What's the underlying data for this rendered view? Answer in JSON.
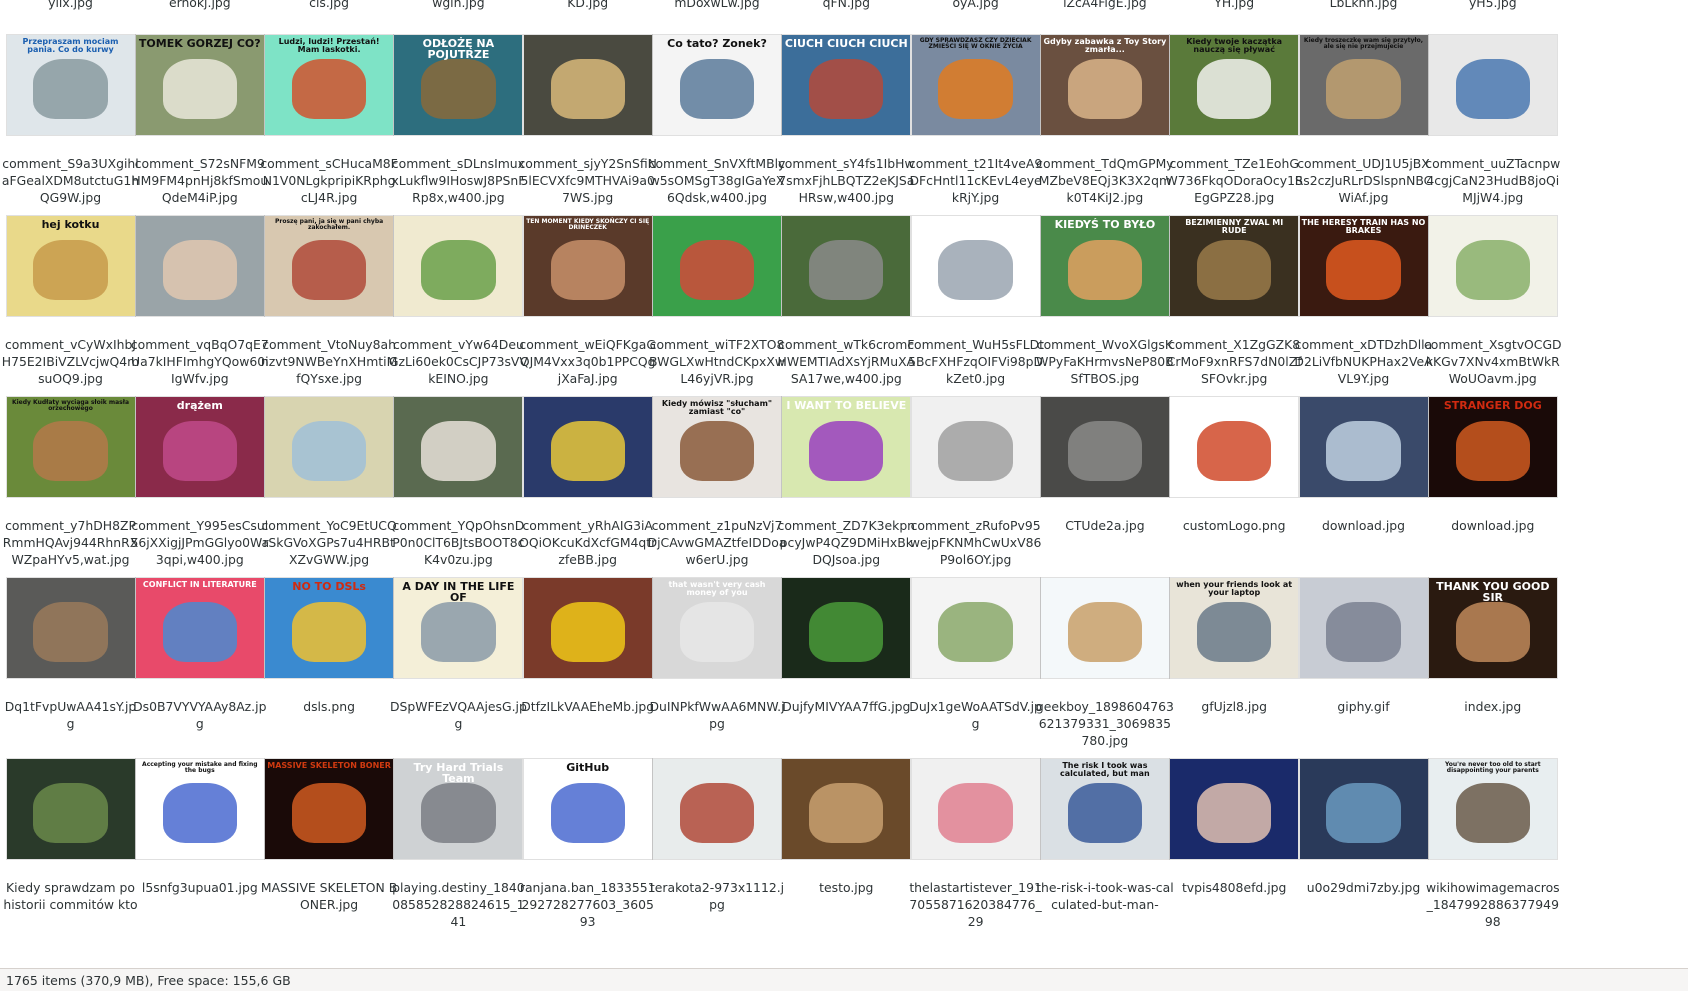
{
  "top_row": {
    "names": [
      "yiix.jpg",
      "ernokj.jpg",
      "cis.jpg",
      "wgin.jpg",
      "KD.jpg",
      "mDoxwLw.jpg",
      "qFN.jpg",
      "oyA.jpg",
      "iZcA4FigE.jpg",
      "YH.jpg",
      "LbLkhh.jpg",
      "yH5.jpg"
    ]
  },
  "rows": [
    {
      "items": [
        {
          "name": "comment_S9a3UXgihlaFGealXDM8utctuG1hQG9W.jpg",
          "thumb": {
            "bg": "#dfe6ea",
            "fg": "#8a9aa0",
            "caption": "Przepraszam mociam pania. Co do kurwy",
            "cap_color": "#1b5fb0"
          }
        },
        {
          "name": "comment_S72sNFM9HM9FM4pnHj8kfSmouQdeM4iP.jpg",
          "thumb": {
            "bg": "#8a9a70",
            "fg": "#e9e7d9",
            "caption": "TOMEK GORZEJ CO?",
            "cap_color": "#111"
          }
        },
        {
          "name": "comment_sCHucaM8FN1V0NLgkpripiKRphgcLJ4R.jpg",
          "thumb": {
            "bg": "#7ee3c6",
            "fg": "#d0542e",
            "caption": "Ludzi, ludzi! Przestań! Mam laskotki.",
            "cap_color": "#111"
          }
        },
        {
          "name": "comment_sDLnsImuxxLukflw9IHoswJ8PSnFRp8x,w400.jpg",
          "thumb": {
            "bg": "#2d6e7e",
            "fg": "#8a6a3a",
            "caption": "ODŁOŻĘ NA POJUTRZE",
            "cap_color": "#ffffff"
          }
        },
        {
          "name": "comment_sjyY2SnSfiN5lECVXfc9MTHVAi9a07WS.jpg",
          "thumb": {
            "bg": "#4a4a40",
            "fg": "#d8b87a",
            "caption": "",
            "cap_color": "#fff"
          }
        },
        {
          "name": "comment_SnVXftMBlyw5sOMSgT38gIGaYeX6Qdsk,w400.jpg",
          "thumb": {
            "bg": "#f4f4f4",
            "fg": "#5a7a9a",
            "caption": "Co tato? Zonek?",
            "cap_color": "#111"
          }
        },
        {
          "name": "comment_sY4fs1IbHw7smxFjhLBQTZ2eKJSaHRsw,w400.jpg",
          "thumb": {
            "bg": "#3c6e9a",
            "fg": "#b44a3a",
            "caption": "CIUCH CIUCH CIUCH",
            "cap_color": "#fff"
          }
        },
        {
          "name": "comment_t21It4veA9DFcHntl11cKEvL4eyekRjY.jpg",
          "thumb": {
            "bg": "#7a8aa0",
            "fg": "#e07a20",
            "caption": "GDY SPRAWDZASZ CZY DZIECIAK ZMIEŚCI SIĘ W OKNIE ŻYCIA",
            "cap_color": "#111"
          }
        },
        {
          "name": "comment_TdQmGPMyMZbeV8EQj3K3X2qmk0T4KiJ2.jpg",
          "thumb": {
            "bg": "#6a5040",
            "fg": "#d9b48a",
            "caption": "Gdyby zabawka z Toy Story zmarła...",
            "cap_color": "#fff"
          }
        },
        {
          "name": "comment_TZe1EohGW736FkqODoraOcy1SEgGPZ28.jpg",
          "thumb": {
            "bg": "#5a7a3a",
            "fg": "#f2f2ee",
            "caption": "Kiedy twoje kaczątka nauczą się pływać",
            "cap_color": "#111"
          }
        },
        {
          "name": "comment_UDJ1U5jBXRs2czJuRLrDSlspnNBCWiAf.jpg",
          "thumb": {
            "bg": "#6a6a6a",
            "fg": "#c0a070",
            "caption": "Kiedy troszeczkę wam się przytyło, ale się nie przejmujecie",
            "cap_color": "#111"
          }
        },
        {
          "name": "comment_uuZTacnpw4cgjCaN23HudB8joQiMJjW4.jpg",
          "thumb": {
            "bg": "#e8e8e8",
            "fg": "#4a78b0",
            "caption": "",
            "cap_color": "#111"
          }
        }
      ]
    },
    {
      "items": [
        {
          "name": "comment_vCyWxIhbJH75E2IBiVZLVcjwQ4msuOQ9.jpg",
          "thumb": {
            "bg": "#e9d98a",
            "fg": "#c79a4a",
            "caption": "hej kotku",
            "cap_color": "#111"
          }
        },
        {
          "name": "comment_vqBqO7qE7Ua7kIHFImhgYQow60iIgWfv.jpg",
          "thumb": {
            "bg": "#9aa4a8",
            "fg": "#e0c8b0",
            "caption": "",
            "cap_color": "#111"
          }
        },
        {
          "name": "comment_VtoNuy8ahnzvt9NWBeYnXHmtiMfQYsxe.jpg",
          "thumb": {
            "bg": "#d8c8b0",
            "fg": "#b04a3a",
            "caption": "Proszę pani, ja się w pani chyba zakochałem.",
            "cap_color": "#111"
          }
        },
        {
          "name": "comment_vYw64DeuGzLi60ek0CsCJP73sVVkEINO.jpg",
          "thumb": {
            "bg": "#f0ead0",
            "fg": "#6aa04a",
            "caption": "",
            "cap_color": "#111"
          }
        },
        {
          "name": "comment_wEiQFKgaGQJM4Vxx3q0b1PPCQgjXaFaJ.jpg",
          "thumb": {
            "bg": "#5a3a2a",
            "fg": "#c8906a",
            "caption": "TEN MOMENT KIEDY SKOŃCZY CI SIĘ DRINECZEK",
            "cap_color": "#fff"
          }
        },
        {
          "name": "comment_wiTF2XTO8BWGLXwHtndCKpxXwL46yjVR.jpg",
          "thumb": {
            "bg": "#3aa04a",
            "fg": "#d04a3a",
            "caption": "",
            "cap_color": "#fff"
          }
        },
        {
          "name": "comment_wTk6cromFHWEMTIAdXsYjRMuXASA17we,w400.jpg",
          "thumb": {
            "bg": "#4a6a3a",
            "fg": "#8a8a8a",
            "caption": "",
            "cap_color": "#fff"
          }
        },
        {
          "name": "comment_WuH5sFLDt5BcFXHFzqOIFVi98pDkZet0.jpg",
          "thumb": {
            "bg": "#ffffff",
            "fg": "#9aa4b0",
            "caption": "",
            "cap_color": "#111"
          }
        },
        {
          "name": "comment_WvoXGlgsKWPyFaKHrmvsNeP80BSfTBOS.jpg",
          "thumb": {
            "bg": "#4a8a4a",
            "fg": "#e0a060",
            "caption": "KIEDYŚ TO BYŁO",
            "cap_color": "#fff"
          }
        },
        {
          "name": "comment_X1ZgGZK8CrMoF9xnRFS7dN0lZfSFOvkr.jpg",
          "thumb": {
            "bg": "#3a3020",
            "fg": "#9a7a4a",
            "caption": "BEZIMIENNY ZWAL MI RUDE",
            "cap_color": "#fff"
          }
        },
        {
          "name": "comment_xDTDzhDllaD2LiVfbNUKPHax2VeAVL9Y.jpg",
          "thumb": {
            "bg": "#3a1a10",
            "fg": "#e05a20",
            "caption": "THE HERESY TRAIN HAS NO BRAKES",
            "cap_color": "#fff"
          }
        },
        {
          "name": "comment_XsgtvOCGDkKGv7XNv4xmBtWkRWoUOavm.jpg",
          "thumb": {
            "bg": "#f2f2e8",
            "fg": "#8ab06a",
            "caption": "",
            "cap_color": "#111"
          }
        }
      ]
    },
    {
      "items": [
        {
          "name": "comment_y7hDH8ZPRmmHQAvj944RhnRXWZpaHYv5,wat.jpg",
          "thumb": {
            "bg": "#6a8a3a",
            "fg": "#b4784a",
            "caption": "Kiedy Kudłaty wyciąga słoik masła orzechowego",
            "cap_color": "#111"
          }
        },
        {
          "name": "comment_Y995esCsul56jXXigjJPmGGlyo0Wa3qpi,w400.jpg",
          "thumb": {
            "bg": "#8a2a4a",
            "fg": "#c04a8a",
            "caption": "drążem",
            "cap_color": "#fff"
          }
        },
        {
          "name": "comment_YoC9EtUCQrSkGVoXGPs7u4HRBtXZvGWW.jpg",
          "thumb": {
            "bg": "#d8d4b0",
            "fg": "#a0c0d8",
            "caption": "",
            "cap_color": "#111"
          }
        },
        {
          "name": "comment_YQpOhsnDP0n0ClT6BJtsBOOT8cK4v0zu.jpg",
          "thumb": {
            "bg": "#5a6a50",
            "fg": "#e8e0d8",
            "caption": "",
            "cap_color": "#111"
          }
        },
        {
          "name": "comment_yRhAIG3iAOQiOKcuKdXcfGM4qtrzfeBB.jpg",
          "thumb": {
            "bg": "#2a3a6a",
            "fg": "#e8c83a",
            "caption": "",
            "cap_color": "#fff"
          }
        },
        {
          "name": "comment_z1puNzVj7DjCAvwGMAZtfeIDDoaw6erU.jpg",
          "thumb": {
            "bg": "#e8e4e0",
            "fg": "#8a5a3a",
            "caption": "Kiedy mówisz \"słucham\" zamiast \"co\"",
            "cap_color": "#111"
          }
        },
        {
          "name": "comment_ZD7K3ekpnpcyJwP4QZ9DMiHxBkDQJsoa.jpg",
          "thumb": {
            "bg": "#d8e8b0",
            "fg": "#9a40c0",
            "caption": "I WANT TO BELIEVE",
            "cap_color": "#fff"
          }
        },
        {
          "name": "comment_zRufoPv95wejpFKNMhCwUxV86P9ol6OY.jpg",
          "thumb": {
            "bg": "#f0f0f0",
            "fg": "#a0a0a0",
            "caption": "",
            "cap_color": "#111"
          }
        },
        {
          "name": "CTUde2a.jpg",
          "thumb": {
            "bg": "#4a4a48",
            "fg": "#8a8a88",
            "caption": "",
            "cap_color": "#fff"
          }
        },
        {
          "name": "customLogo.png",
          "thumb": {
            "bg": "#ffffff",
            "fg": "#d04a2a",
            "caption": "",
            "cap_color": "#111"
          }
        },
        {
          "name": "download.jpg",
          "thumb": {
            "bg": "#3a4a6a",
            "fg": "#c0d0e0",
            "caption": "",
            "cap_color": "#fff"
          }
        },
        {
          "name": "download.jpg",
          "thumb": {
            "bg": "#1a0a08",
            "fg": "#d05a20",
            "caption": "STRANGER DOG",
            "cap_color": "#d02a10"
          }
        }
      ]
    },
    {
      "items": [
        {
          "name": "Dq1tFvpUwAA41sY.jpg",
          "thumb": {
            "bg": "#5a5a58",
            "fg": "#9a7a5a",
            "caption": "",
            "cap_color": "#fff"
          }
        },
        {
          "name": "Ds0B7VYVYAAy8Az.jpg",
          "thumb": {
            "bg": "#e84a6a",
            "fg": "#4a8ad0",
            "caption": "CONFLICT IN LITERATURE",
            "cap_color": "#fff"
          }
        },
        {
          "name": "dsls.png",
          "thumb": {
            "bg": "#3a8ad0",
            "fg": "#f0c030",
            "caption": "NO TO DSLs",
            "cap_color": "#d02a10"
          }
        },
        {
          "name": "DSpWFEzVQAAjesG.jpg",
          "thumb": {
            "bg": "#f4efd8",
            "fg": "#8a9aa8",
            "caption": "A DAY IN THE LIFE OF",
            "cap_color": "#111"
          }
        },
        {
          "name": "DtfzILkVAAEheMb.jpg",
          "thumb": {
            "bg": "#7a3a2a",
            "fg": "#f0c818",
            "caption": "",
            "cap_color": "#111"
          }
        },
        {
          "name": "DuINPkfWwAA6MNW.jpg",
          "thumb": {
            "bg": "#d8d8d8",
            "fg": "#e8e8e8",
            "caption": "that wasn't very cash money of you",
            "cap_color": "#fff"
          }
        },
        {
          "name": "DujfyMIVYAA7ffG.jpg",
          "thumb": {
            "bg": "#1a2a1a",
            "fg": "#4a9a3a",
            "caption": "",
            "cap_color": "#fff"
          }
        },
        {
          "name": "DuJx1geWoAATSdV.jpg",
          "thumb": {
            "bg": "#f4f4f4",
            "fg": "#8aa86a",
            "caption": "",
            "cap_color": "#111"
          }
        },
        {
          "name": "geekboy_1898604763621379331_3069835780.jpg",
          "thumb": {
            "bg": "#f4f8fa",
            "fg": "#c8a068",
            "caption": "",
            "cap_color": "#111"
          }
        },
        {
          "name": "gfUjzl8.jpg",
          "thumb": {
            "bg": "#e8e4d8",
            "fg": "#6a7a8a",
            "caption": "when your friends look at your laptop",
            "cap_color": "#111"
          }
        },
        {
          "name": "giphy.gif",
          "thumb": {
            "bg": "#c8ccd4",
            "fg": "#7a8090",
            "caption": "",
            "cap_color": "#111"
          }
        },
        {
          "name": "index.jpg",
          "thumb": {
            "bg": "#2a1a10",
            "fg": "#c08a5a",
            "caption": "THANK YOU GOOD SIR",
            "cap_color": "#fff"
          }
        }
      ]
    },
    {
      "items": [
        {
          "name": "Kiedy sprawdzam po historii commitów kto",
          "thumb": {
            "bg": "#2a3a2a",
            "fg": "#6a8a4a",
            "caption": "",
            "cap_color": "#fff"
          }
        },
        {
          "name": "l5snfg3upua01.jpg",
          "thumb": {
            "bg": "#ffffff",
            "fg": "#4a6ad0",
            "caption": "Accepting your mistake and fixing the bugs",
            "cap_color": "#111"
          }
        },
        {
          "name": "MASSIVE SKELETON BONER.jpg",
          "thumb": {
            "bg": "#1a0a08",
            "fg": "#d05a20",
            "caption": "MASSIVE SKELETON BONER",
            "cap_color": "#d03a10"
          }
        },
        {
          "name": "playing.destiny_1840085852828824615_141",
          "thumb": {
            "bg": "#cfd2d4",
            "fg": "#7a7e84",
            "caption": "Try Hard Trials Team",
            "cap_color": "#fff"
          }
        },
        {
          "name": "ranjana.ban_1833551292728277603_360593",
          "thumb": {
            "bg": "#ffffff",
            "fg": "#4a6ad0",
            "caption": "GitHub",
            "cap_color": "#111"
          }
        },
        {
          "name": "terakota2-973x1112.jpg",
          "thumb": {
            "bg": "#e8ecec",
            "fg": "#b04a3a",
            "caption": "",
            "cap_color": "#111"
          }
        },
        {
          "name": "testo.jpg",
          "thumb": {
            "bg": "#6a4a2a",
            "fg": "#c8a070",
            "caption": "",
            "cap_color": "#fff"
          }
        },
        {
          "name": "thelastartistever_1917055871620384776_29",
          "thumb": {
            "bg": "#f0f0f0",
            "fg": "#e08090",
            "caption": "",
            "cap_color": "#111"
          }
        },
        {
          "name": "the-risk-i-took-was-calculated-but-man-",
          "thumb": {
            "bg": "#dae0e4",
            "fg": "#3a5a9a",
            "caption": "The risk I took was calculated, but man",
            "cap_color": "#111"
          }
        },
        {
          "name": "tvpis4808efd.jpg",
          "thumb": {
            "bg": "#1a2a6a",
            "fg": "#e0c0b0",
            "caption": "",
            "cap_color": "#fff"
          }
        },
        {
          "name": "u0o29dmi7zby.jpg",
          "thumb": {
            "bg": "#2a3a5a",
            "fg": "#6a9ac0",
            "caption": "",
            "cap_color": "#fff"
          }
        },
        {
          "name": "wikihowimagemacros_184799288637794998",
          "thumb": {
            "bg": "#e8eef0",
            "fg": "#6a5a4a",
            "caption": "You're never too old to start disappointing your parents",
            "cap_color": "#111"
          }
        }
      ]
    }
  ],
  "statusbar": {
    "text": "1765 items (370,9 MB), Free space: 155,6 GB"
  }
}
